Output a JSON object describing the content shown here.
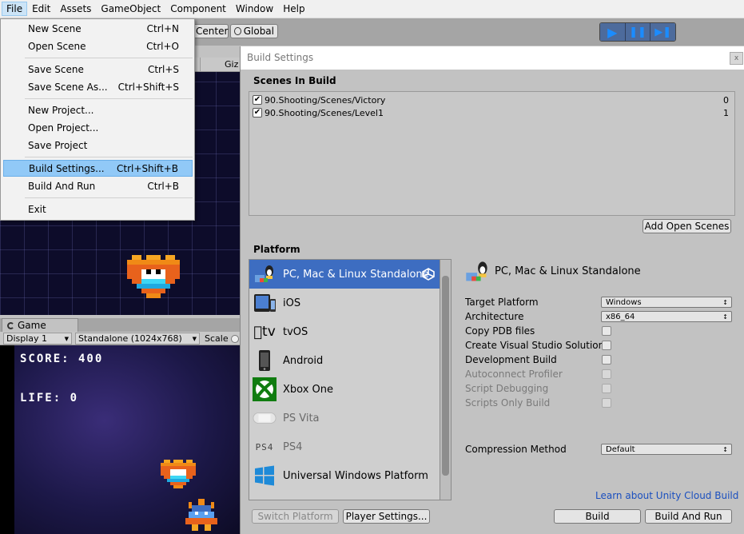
{
  "menubar": {
    "items": [
      "File",
      "Edit",
      "Assets",
      "GameObject",
      "Component",
      "Window",
      "Help"
    ]
  },
  "toolbar": {
    "center_label": "Center",
    "global_label": "Global",
    "gizmos_label": "Giz"
  },
  "file_menu": {
    "items": [
      {
        "label": "New Scene",
        "shortcut": "Ctrl+N"
      },
      {
        "label": "Open Scene",
        "shortcut": "Ctrl+O"
      },
      {
        "label": "Save Scene",
        "shortcut": "Ctrl+S"
      },
      {
        "label": "Save Scene As...",
        "shortcut": "Ctrl+Shift+S"
      },
      {
        "label": "New Project...",
        "shortcut": ""
      },
      {
        "label": "Open Project...",
        "shortcut": ""
      },
      {
        "label": "Save Project",
        "shortcut": ""
      },
      {
        "label": "Build Settings...",
        "shortcut": "Ctrl+Shift+B"
      },
      {
        "label": "Build And Run",
        "shortcut": "Ctrl+B"
      },
      {
        "label": "Exit",
        "shortcut": ""
      }
    ]
  },
  "game": {
    "tab_label": "Game",
    "display": "Display 1",
    "resolution": "Standalone (1024x768)",
    "scale": "Scale",
    "score": "SCORE: 400",
    "life": "LIFE: 0"
  },
  "build_settings": {
    "title": "Build Settings",
    "close": "x",
    "scenes_title": "Scenes In Build",
    "scenes": [
      {
        "path": "90.Shooting/Scenes/Victory",
        "index": "0"
      },
      {
        "path": "90.Shooting/Scenes/Level1",
        "index": "1"
      }
    ],
    "add_open_scenes": "Add Open Scenes",
    "platform_title": "Platform",
    "platforms": [
      {
        "label": "PC, Mac & Linux Standalone",
        "icon": "pc-mac-linux-icon"
      },
      {
        "label": "iOS",
        "icon": "ios-icon"
      },
      {
        "label": "tvOS",
        "icon": "tvos-icon"
      },
      {
        "label": "Android",
        "icon": "android-icon"
      },
      {
        "label": "Xbox One",
        "icon": "xbox-icon"
      },
      {
        "label": "PS Vita",
        "icon": "ps-vita-icon"
      },
      {
        "label": "PS4",
        "icon": "ps4-icon"
      },
      {
        "label": "Universal Windows Platform",
        "icon": "windows-icon"
      }
    ],
    "selected_platform": "PC, Mac & Linux Standalone",
    "options": {
      "target_platform_label": "Target Platform",
      "target_platform_value": "Windows",
      "architecture_label": "Architecture",
      "architecture_value": "x86_64",
      "copy_pdb_label": "Copy PDB files",
      "create_vs_label": "Create Visual Studio Solution",
      "dev_build_label": "Development Build",
      "autoconnect_label": "Autoconnect Profiler",
      "script_debug_label": "Script Debugging",
      "scripts_only_label": "Scripts Only Build",
      "compression_label": "Compression Method",
      "compression_value": "Default"
    },
    "cloud_link": "Learn about Unity Cloud Build",
    "switch_platform": "Switch Platform",
    "player_settings": "Player Settings...",
    "build": "Build",
    "build_and_run": "Build And Run"
  },
  "colors": {
    "selected_platform_bg": "#3d6dc1",
    "menu_highlight": "#91c9f7",
    "link": "#1a4fbf"
  }
}
